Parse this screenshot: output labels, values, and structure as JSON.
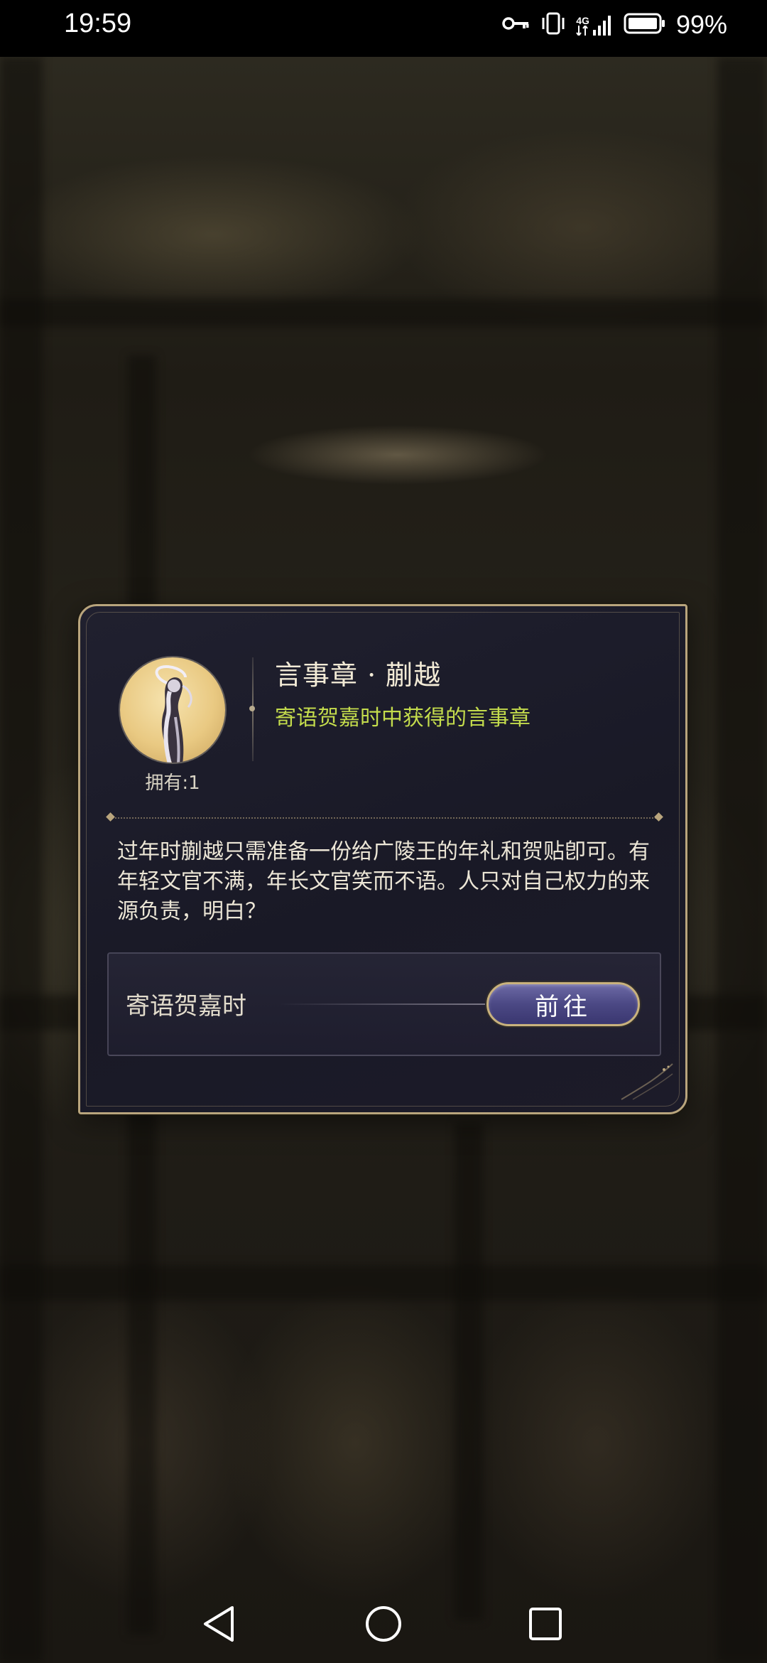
{
  "status_bar": {
    "time": "19:59",
    "network": "4G",
    "battery": "99%"
  },
  "dialog": {
    "title": "言事章 · 蒯越",
    "source_text": "寄语贺嘉时中获得的言事章",
    "owned": "拥有:1",
    "description": "过年时蒯越只需准备一份给广陵王的年礼和贺贴卽可。有年轻文官不满，年长文官笑而不语。人只对自己权力的来源负责，明白？",
    "source_row": {
      "label": "寄语贺嘉时",
      "button_label": "前往"
    }
  },
  "colors": {
    "accent_gold": "#b9a57d",
    "source_green": "#c4dc4c",
    "button_purple": "#4b4884"
  },
  "icons": [
    "key-icon",
    "vibrate-icon",
    "signal-icon",
    "battery-icon",
    "back-icon",
    "home-icon",
    "recents-icon",
    "medal-icon"
  ]
}
